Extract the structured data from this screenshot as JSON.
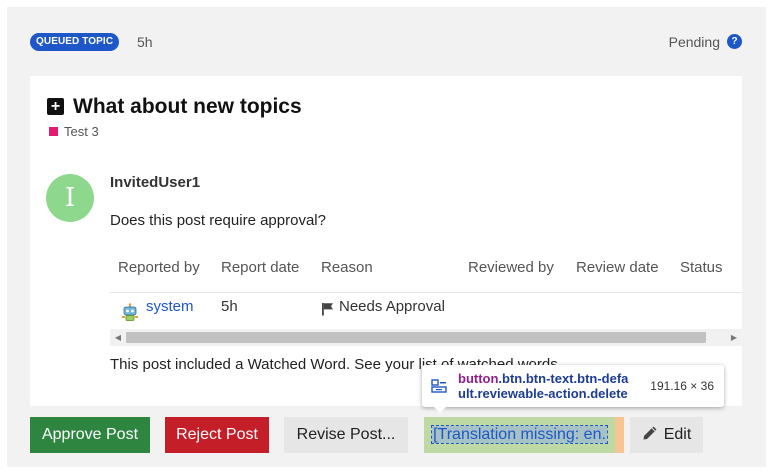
{
  "header": {
    "badge": "QUEUED TOPIC",
    "age": "5h",
    "status": "Pending",
    "help_icon": "?"
  },
  "topic": {
    "title": "What about new topics",
    "category": "Test 3",
    "category_color": "#e5196d"
  },
  "post": {
    "avatar_letter": "I",
    "username": "InvitedUser1",
    "text": "Does this post require approval?"
  },
  "table": {
    "headers": [
      "Reported by",
      "Report date",
      "Reason",
      "Reviewed by",
      "Review date",
      "Status"
    ],
    "row": {
      "reporter": "system",
      "date": "5h",
      "reason": "Needs Approval"
    }
  },
  "watched_text": "This post included a Watched Word. See your list of watched words.",
  "actions": {
    "approve": "Approve Post",
    "reject": "Reject Post",
    "revise": "Revise Post...",
    "delete": "[Translation missing: en.",
    "edit": "Edit"
  },
  "tooltip": {
    "tag": "button",
    "selector_line1": ".btn.btn-text.btn-defa",
    "selector_line2": "ult.reviewable-action.delete",
    "size": "191.16 × 36"
  },
  "colors": {
    "badge": "#1e57c7",
    "approve": "#2e8540",
    "reject": "#c41e28"
  }
}
